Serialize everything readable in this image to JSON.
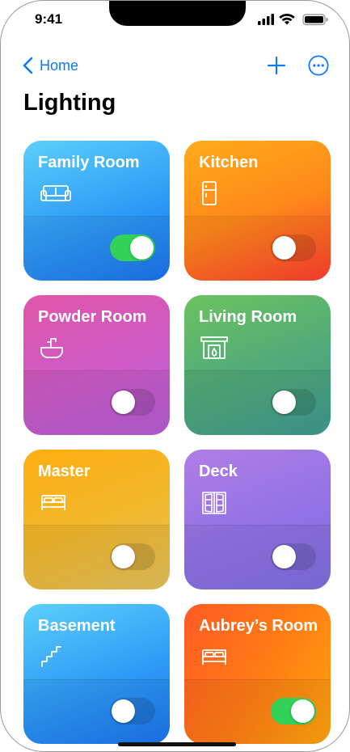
{
  "status_bar": {
    "time": "9:41"
  },
  "nav": {
    "back_label": "Home"
  },
  "page": {
    "title": "Lighting"
  },
  "rooms": [
    {
      "label": "Family Room",
      "icon": "sofa-icon",
      "on": true
    },
    {
      "label": "Kitchen",
      "icon": "refrigerator-icon",
      "on": false
    },
    {
      "label": "Powder Room",
      "icon": "sink-icon",
      "on": false
    },
    {
      "label": "Living Room",
      "icon": "fireplace-icon",
      "on": false
    },
    {
      "label": "Master",
      "icon": "bed-icon",
      "on": false
    },
    {
      "label": "Deck",
      "icon": "french-doors-icon",
      "on": false
    },
    {
      "label": "Basement",
      "icon": "stairs-icon",
      "on": false
    },
    {
      "label": "Aubrey’s Room",
      "icon": "bed-icon",
      "on": true
    }
  ],
  "colors": {
    "accent": "#0a7aff",
    "toggle_on": "#32d158"
  }
}
